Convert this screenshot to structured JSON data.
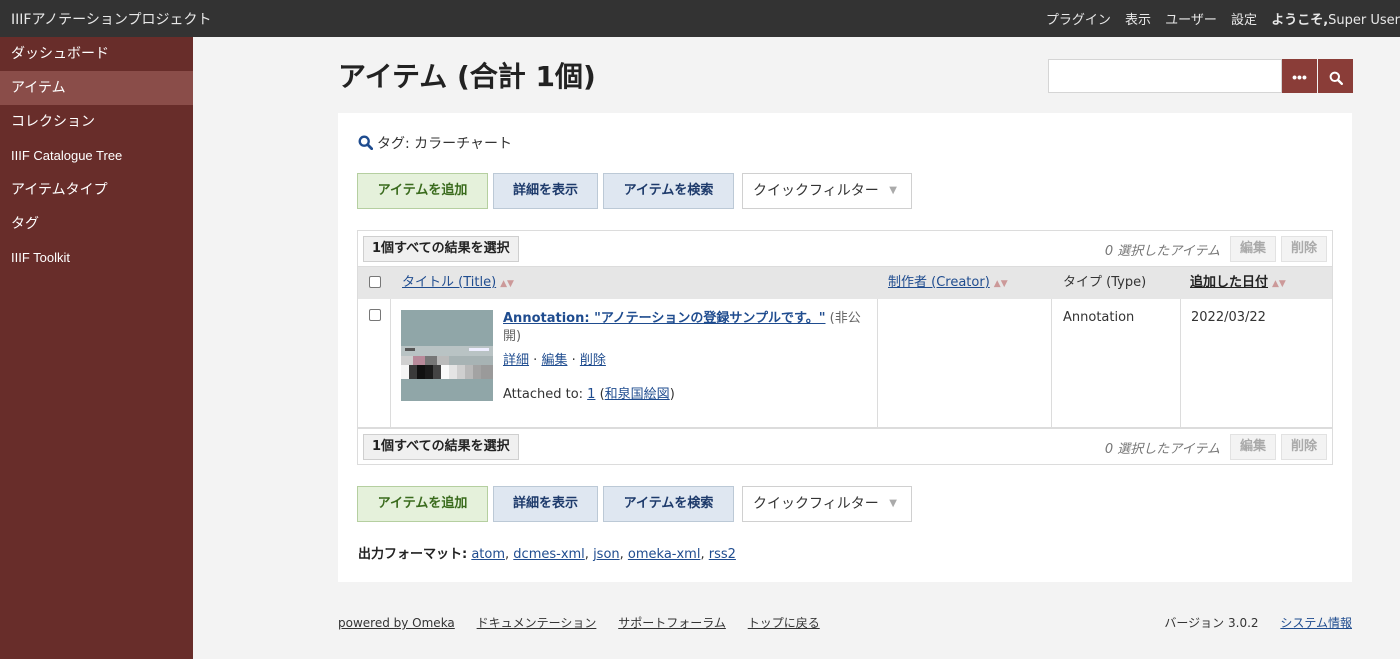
{
  "topbar": {
    "site_title": "IIIFアノテーションプロジェクト",
    "nav": [
      "プラグイン",
      "表示",
      "ユーザー",
      "設定"
    ],
    "welcome": "ようこそ,",
    "user": "Super User"
  },
  "sidebar": {
    "items": [
      {
        "label": "ダッシュボード"
      },
      {
        "label": "アイテム"
      },
      {
        "label": "コレクション"
      },
      {
        "label": "IIIF Catalogue Tree"
      },
      {
        "label": "アイテムタイプ"
      },
      {
        "label": "タグ"
      },
      {
        "label": "IIIF Toolkit"
      }
    ],
    "active_index": 1
  },
  "header": {
    "title": "アイテム (合計 1個)",
    "search_value": "",
    "advanced_icon": "ellipsis-icon",
    "search_icon": "search-icon"
  },
  "filter": {
    "label": "タグ: カラーチャート"
  },
  "actions": {
    "add_item": "アイテムを追加",
    "show_details": "詳細を表示",
    "search_items": "アイテムを検索",
    "quick_filter": "クイックフィルター"
  },
  "batch": {
    "select_all": "1個すべての結果を選択",
    "selected_count": "0 選択したアイテム",
    "edit": "編集",
    "delete": "削除"
  },
  "table": {
    "columns": {
      "title": "タイトル (Title)",
      "creator": "制作者 (Creator)",
      "type": "タイプ (Type)",
      "date_added": "追加した日付"
    },
    "rows": [
      {
        "title": "Annotation: \"アノテーションの登録サンプルです。\"",
        "visibility": "(非公開)",
        "link_details": "詳細",
        "link_edit": "編集",
        "link_delete": "削除",
        "separator": "·",
        "attached_label": "Attached to:",
        "attached_id": "1",
        "attached_title": "和泉国絵図",
        "creator": "",
        "type": "Annotation",
        "date_added": "2022/03/22"
      }
    ]
  },
  "formats": {
    "label": "出力フォーマット:",
    "items": [
      "atom",
      "dcmes-xml",
      "json",
      "omeka-xml",
      "rss2"
    ]
  },
  "footer": {
    "powered": "powered by Omeka",
    "docs": "ドキュメンテーション",
    "forums": "サポートフォーラム",
    "to_top": "トップに戻る",
    "version": "バージョン 3.0.2",
    "system_info": "システム情報"
  },
  "colors": {
    "topbar": "#333333",
    "sidebar": "#682d2a",
    "sidebar_active": "#8a4d49",
    "accent_button": "#8a3d38",
    "link": "#1f4c8f"
  }
}
